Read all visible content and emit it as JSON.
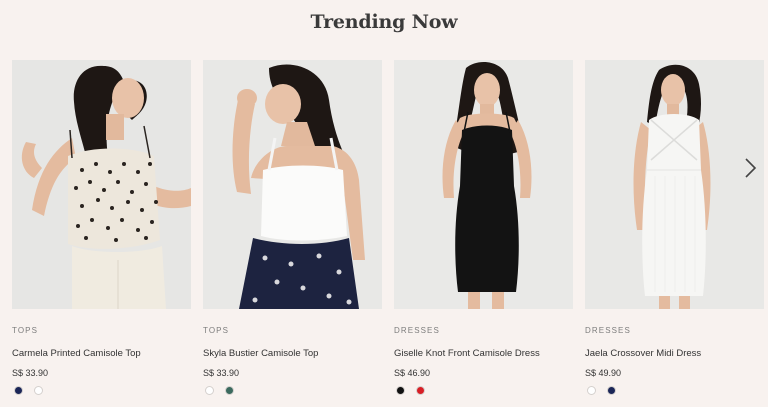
{
  "section": {
    "title": "Trending Now"
  },
  "products": [
    {
      "category": "TOPS",
      "name": "Carmela Printed Camisole Top",
      "price": "S$ 33.90",
      "swatches": [
        {
          "color": "#1b2657",
          "label": "navy"
        },
        {
          "color": "#ffffff",
          "label": "white"
        }
      ]
    },
    {
      "category": "TOPS",
      "name": "Skyla Bustier Camisole Top",
      "price": "S$ 33.90",
      "swatches": [
        {
          "color": "#ffffff",
          "label": "white"
        },
        {
          "color": "#3b6a5e",
          "label": "green"
        }
      ]
    },
    {
      "category": "DRESSES",
      "name": "Giselle Knot Front Camisole Dress",
      "price": "S$ 46.90",
      "swatches": [
        {
          "color": "#111111",
          "label": "black"
        },
        {
          "color": "#d81f26",
          "label": "red"
        }
      ]
    },
    {
      "category": "DRESSES",
      "name": "Jaela Crossover Midi Dress",
      "price": "S$ 49.90",
      "swatches": [
        {
          "color": "#ffffff",
          "label": "white"
        },
        {
          "color": "#1b2657",
          "label": "navy"
        }
      ]
    }
  ],
  "carousel": {
    "next_icon": "chevron-right-icon"
  }
}
